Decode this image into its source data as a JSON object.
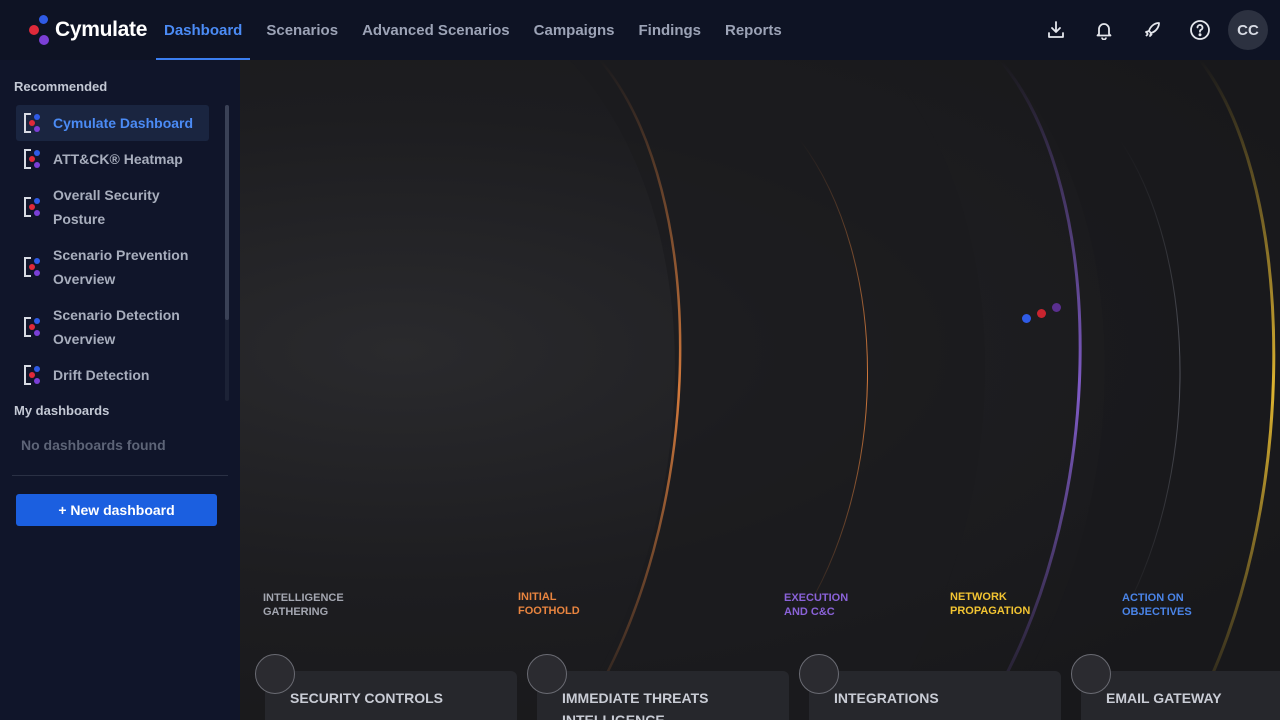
{
  "app": {
    "brand": "Cymulate"
  },
  "nav": {
    "items": [
      "Dashboard",
      "Scenarios",
      "Advanced Scenarios",
      "Campaigns",
      "Findings",
      "Reports"
    ],
    "active": "Dashboard"
  },
  "top_icons": [
    "download-icon",
    "bell-icon",
    "rocket-icon",
    "help-icon"
  ],
  "user": {
    "initials": "CC"
  },
  "sidebar": {
    "recommended_title": "Recommended",
    "items": [
      {
        "label": "Cymulate Dashboard",
        "active": true
      },
      {
        "label": "ATT&CK® Heatmap",
        "active": false
      },
      {
        "label": "Overall Security Posture",
        "active": false
      },
      {
        "label": "Scenario Prevention Overview",
        "active": false
      },
      {
        "label": "Scenario Detection Overview",
        "active": false
      },
      {
        "label": "Drift Detection",
        "active": false
      }
    ],
    "my_title": "My dashboards",
    "empty_text": "No dashboards found",
    "new_button": "+ New dashboard"
  },
  "stages": [
    {
      "label": "Intelligence gathering",
      "color": "#a3a6b0"
    },
    {
      "label": "Initial foothold",
      "color": "#e8843f"
    },
    {
      "label": "Execution and C&C",
      "color": "#8a62d8"
    },
    {
      "label": "Network propagation",
      "color": "#f2c432"
    },
    {
      "label": "Action on objectives",
      "color": "#4a84e8"
    }
  ],
  "cards": [
    {
      "title": "SECURITY CONTROLS"
    },
    {
      "title": "IMMEDIATE THREATS INTELLIGENCE"
    },
    {
      "title": "INTEGRATIONS"
    },
    {
      "title": "EMAIL GATEWAY"
    }
  ],
  "colors": {
    "accent": "#3b7ef0",
    "button": "#1b5fe0",
    "brand_blue": "#2f5be6",
    "brand_red": "#e02a3a",
    "brand_purple": "#7b3fd6"
  }
}
